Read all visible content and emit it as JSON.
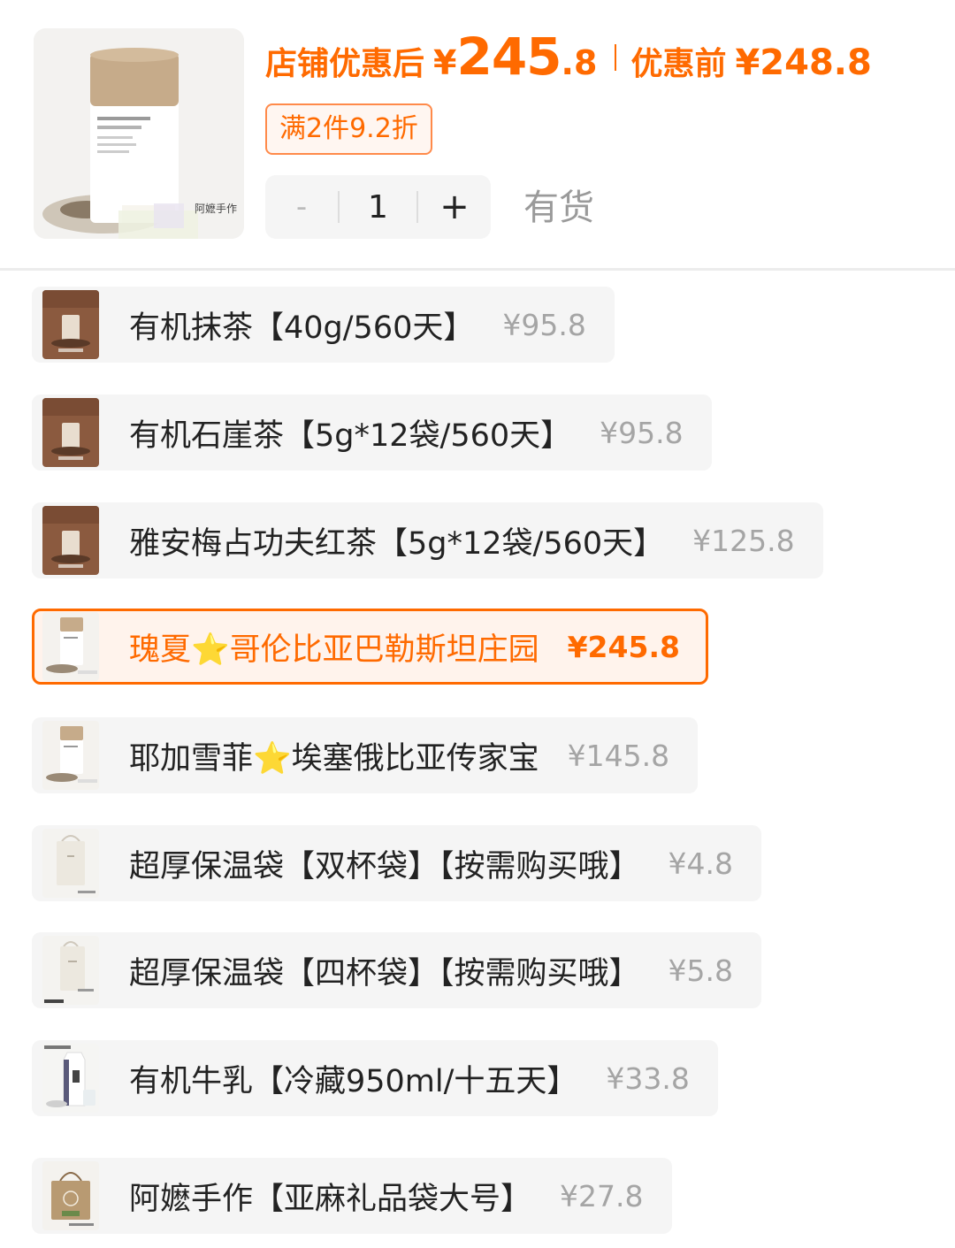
{
  "product": {
    "thumbnail_label": "阿嬷手作"
  },
  "price": {
    "after_label": "店铺优惠后",
    "currency": "¥",
    "after_int": "245",
    "after_dec": ".8",
    "before_label": "优惠前",
    "before_price": "¥248.8"
  },
  "promo_tag": "满2件9.2折",
  "quantity": {
    "minus": "-",
    "value": "1",
    "plus": "+"
  },
  "stock_status": "有货",
  "options": [
    {
      "name": "有机抹茶【40g/560天】",
      "price": "¥95.8",
      "thumb": "brown-cup"
    },
    {
      "name": "有机石崖茶【5g*12袋/560天】",
      "price": "¥95.8",
      "thumb": "brown-cup"
    },
    {
      "name": "雅安梅占功夫红茶【5g*12袋/560天】",
      "price": "¥125.8",
      "thumb": "brown-cup"
    },
    {
      "name": "瑰夏⭐哥伦比亚巴勒斯坦庄园",
      "price": "¥245.8",
      "thumb": "coffee-can",
      "selected": true
    },
    {
      "name": "耶加雪菲⭐埃塞俄比亚传家宝",
      "price": "¥145.8",
      "thumb": "coffee-can"
    },
    {
      "name": "超厚保温袋【双杯袋】【按需购买哦】",
      "price": "¥4.8",
      "thumb": "white-bag"
    },
    {
      "name": "超厚保温袋【四杯袋】【按需购买哦】",
      "price": "¥5.8",
      "thumb": "white-bag"
    },
    {
      "name": "有机牛乳【冷藏950ml/十五天】",
      "price": "¥33.8",
      "thumb": "milk-carton"
    },
    {
      "name": "阿嬷手作【亚麻礼品袋大号】",
      "price": "¥27.8",
      "thumb": "linen-bag"
    }
  ],
  "colors": {
    "accent": "#ff6a00",
    "row_bg": "#f5f5f5",
    "price_grey": "#a5a5a5"
  }
}
